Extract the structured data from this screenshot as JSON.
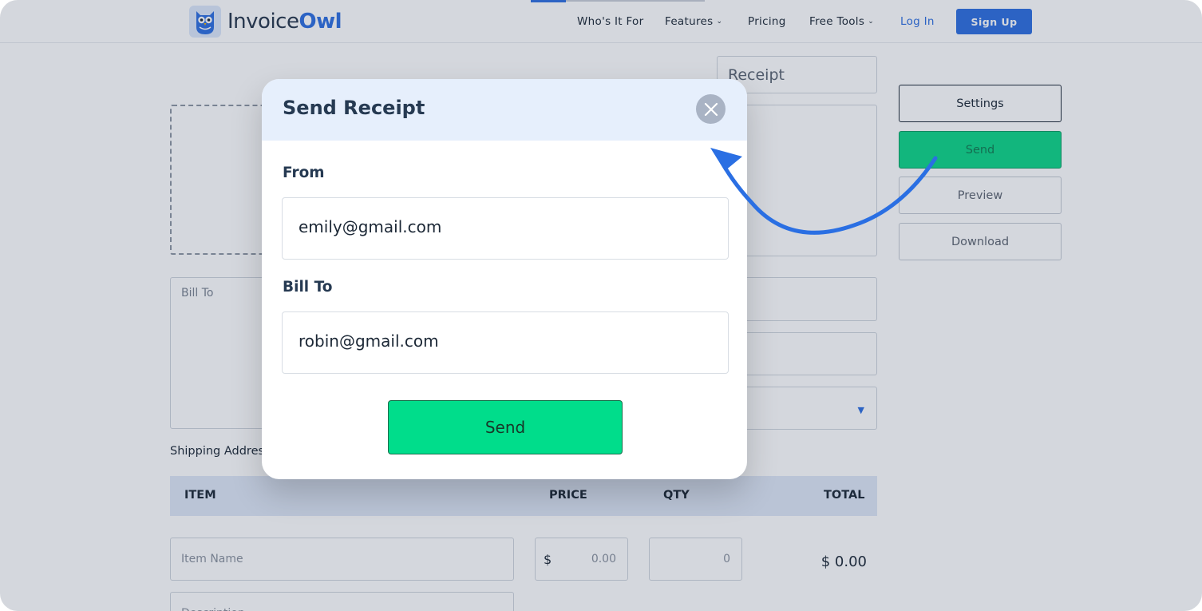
{
  "header": {
    "logo_part1": "Invoice",
    "logo_part2": "Owl",
    "nav": [
      {
        "label": "Who's It For"
      },
      {
        "label": "Features"
      },
      {
        "label": "Pricing"
      },
      {
        "label": "Free Tools"
      },
      {
        "label": "Log In"
      }
    ],
    "signup_label": "Sign Up"
  },
  "form": {
    "document_title": "Receipt",
    "bill_to_placeholder": "Bill To",
    "shipping_label": "Shipping Addres",
    "table_headers": {
      "item": "ITEM",
      "price": "PRICE",
      "qty": "QTY",
      "total": "TOTAL"
    },
    "item_name_placeholder": "Item Name",
    "currency_symbol": "$",
    "price_value": "0.00",
    "qty_value": "0",
    "row_total": "$ 0.00",
    "description_placeholder": "Description"
  },
  "side_actions": {
    "settings": "Settings",
    "send": "Send",
    "preview": "Preview",
    "download": "Download"
  },
  "modal": {
    "title": "Send Receipt",
    "from_label": "From",
    "from_value": "emily@gmail.com",
    "bill_to_label": "Bill To",
    "bill_to_value": "robin@gmail.com",
    "send_label": "Send"
  },
  "colors": {
    "brand_blue": "#2d6fe0",
    "send_green": "#00dd8b",
    "arrow_blue": "#2a6fe3"
  },
  "icons": [
    "owl-logo-icon",
    "close-icon",
    "chevron-down-icon",
    "curved-arrow-icon"
  ]
}
